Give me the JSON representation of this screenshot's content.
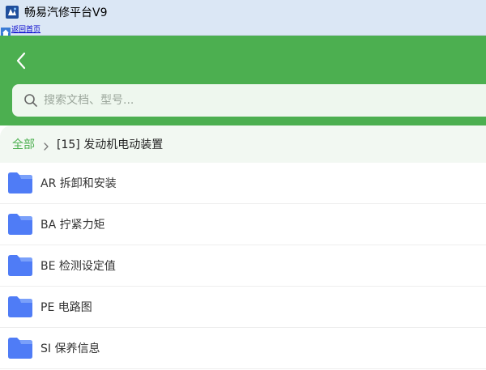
{
  "window": {
    "title": "畅易汽修平台V9"
  },
  "linkbar": {
    "home_link": "返回首页"
  },
  "search": {
    "placeholder": "搜索文档、型号..."
  },
  "breadcrumb": {
    "root": "全部",
    "current": "[15] 发动机电动装置"
  },
  "items": [
    {
      "label": "AR 拆卸和安装"
    },
    {
      "label": "BA 拧紧力矩"
    },
    {
      "label": "BE 检测设定值"
    },
    {
      "label": "PE 电路图"
    },
    {
      "label": "SI 保养信息"
    }
  ],
  "colors": {
    "primary": "#4caf50",
    "folder": "#4f7cf6",
    "titlebar": "#dbe7f5"
  }
}
